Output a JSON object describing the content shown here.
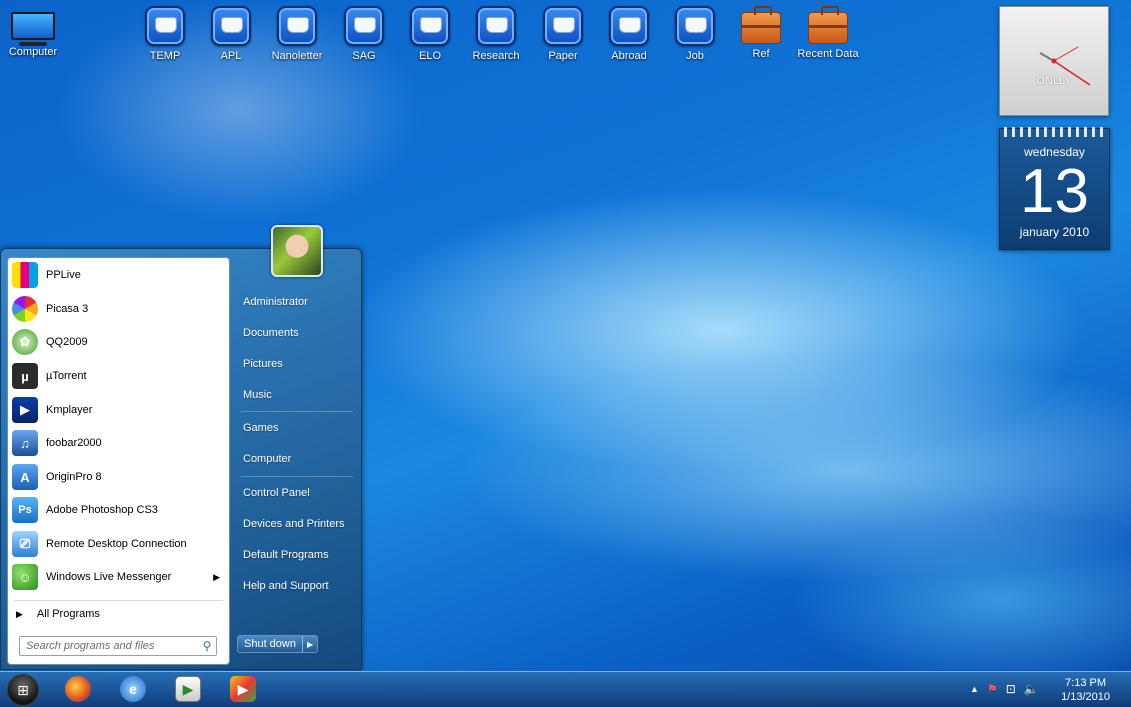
{
  "desktop": {
    "computer_label": "Computer",
    "icons": [
      {
        "label": "TEMP"
      },
      {
        "label": "APL"
      },
      {
        "label": "Nanoletter"
      },
      {
        "label": "SAG"
      },
      {
        "label": "ELO"
      },
      {
        "label": "Research"
      },
      {
        "label": "Paper"
      },
      {
        "label": "Abroad"
      },
      {
        "label": "Job"
      },
      {
        "label": "Ref"
      },
      {
        "label": "Recent Data"
      }
    ]
  },
  "gadgets": {
    "clock_brand": "ONLLY",
    "calendar": {
      "weekday": "wednesday",
      "day": "13",
      "month_year": "january 2010"
    }
  },
  "start_menu": {
    "programs": [
      {
        "label": "PPLive",
        "icon": "pplive-icon"
      },
      {
        "label": "Picasa 3",
        "icon": "picasa-icon"
      },
      {
        "label": "QQ2009",
        "icon": "qq-icon"
      },
      {
        "label": "µTorrent",
        "icon": "utorrent-icon"
      },
      {
        "label": "Kmplayer",
        "icon": "kmplayer-icon"
      },
      {
        "label": "foobar2000",
        "icon": "foobar-icon"
      },
      {
        "label": "OriginPro 8",
        "icon": "originpro-icon"
      },
      {
        "label": "Adobe Photoshop CS3",
        "icon": "photoshop-icon"
      },
      {
        "label": "Remote Desktop Connection",
        "icon": "remote-desktop-icon"
      },
      {
        "label": "Windows Live Messenger",
        "icon": "messenger-icon"
      }
    ],
    "all_programs": "All Programs",
    "search_placeholder": "Search programs and files",
    "right_links": {
      "user": "Administrator",
      "documents": "Documents",
      "pictures": "Pictures",
      "music": "Music",
      "games": "Games",
      "computer": "Computer",
      "control_panel": "Control Panel",
      "devices": "Devices and Printers",
      "default_programs": "Default Programs",
      "help": "Help and Support"
    },
    "shutdown_label": "Shut down"
  },
  "taskbar": {
    "time": "7:13 PM",
    "date": "1/13/2010"
  }
}
